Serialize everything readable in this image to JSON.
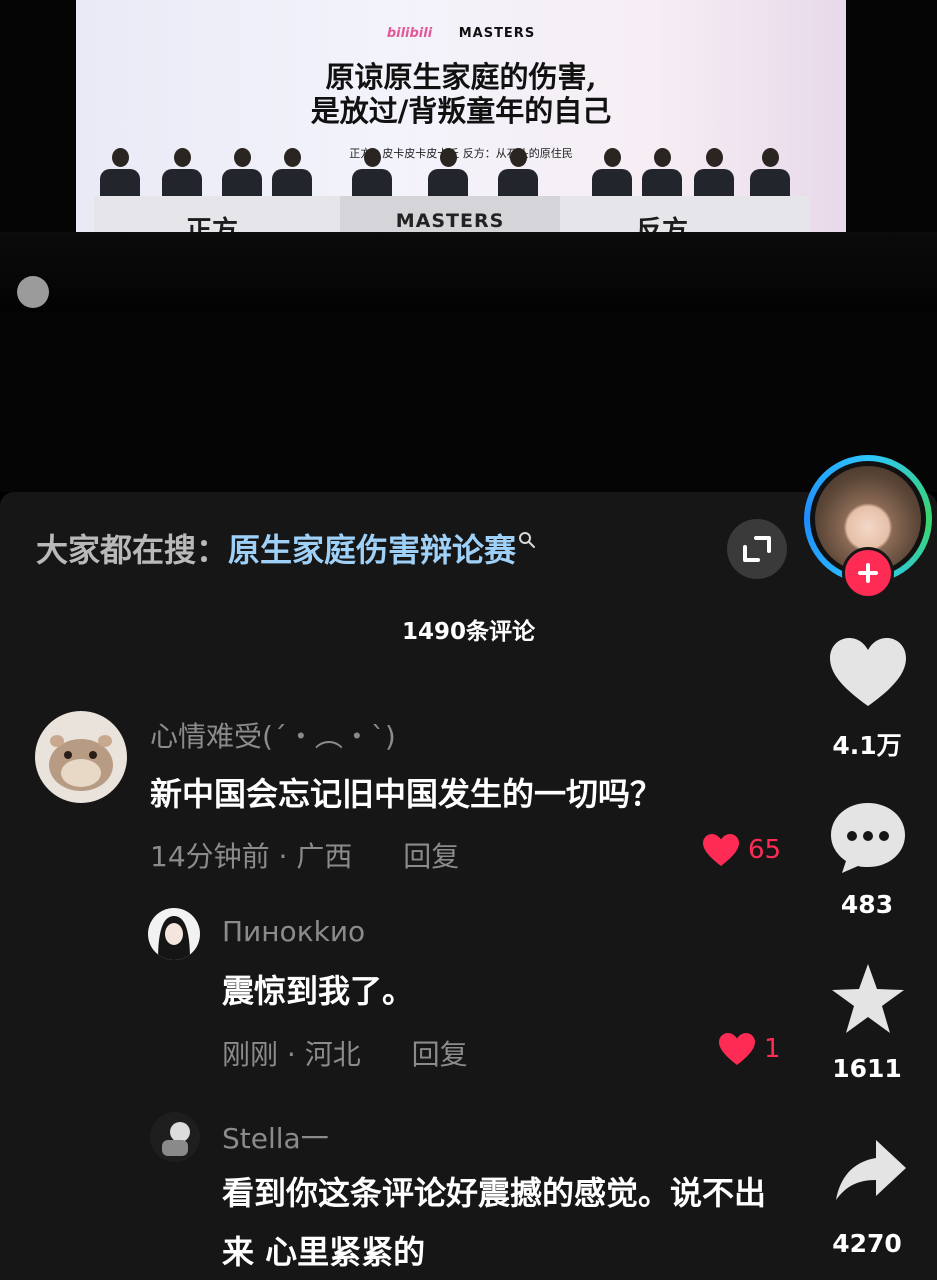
{
  "video": {
    "logo_left": "bilibili",
    "logo_right": "MASTERS",
    "title_line1": "原谅原生家庭的伤害,",
    "title_line2": "是放过/背叛童年的自己",
    "sides_text": "正方：皮卡皮卡皮卡丘   反方：从石头的原住民",
    "pro_sign": "正方",
    "con_sign": "反方",
    "center_sign": "MASTERS"
  },
  "search": {
    "prefix": "大家都在搜：",
    "term": "原生家庭伤害辩论赛"
  },
  "comments_count": "1490条评论",
  "comments": [
    {
      "username": "心情难受(´・︵・`)",
      "text": "新中国会忘记旧中国发生的一切吗？",
      "time": "14分钟前",
      "location": "广西",
      "reply_label": "回复",
      "likes": "65",
      "avatar_icon": "hamster-avatar"
    }
  ],
  "replies": [
    {
      "username": "Пинокkио",
      "text": "震惊到我了。",
      "time": "刚刚",
      "location": "河北",
      "reply_label": "回复",
      "likes": "1",
      "avatar_icon": "girl-avatar"
    },
    {
      "username": "Stella一",
      "text_line1": "看到你这条评论好震撼的感觉。说不出",
      "text_line2": "来 心里紧紧的",
      "avatar_icon": "cartoon-avatar"
    }
  ],
  "rail": {
    "likes": "4.1万",
    "comments": "483",
    "favorites": "1611",
    "shares": "4270"
  },
  "colors": {
    "sheet_bg": "#161616",
    "search_term": "#9fd0f7",
    "like_red": "#fe2c55",
    "muted": "#8b8b8b"
  }
}
